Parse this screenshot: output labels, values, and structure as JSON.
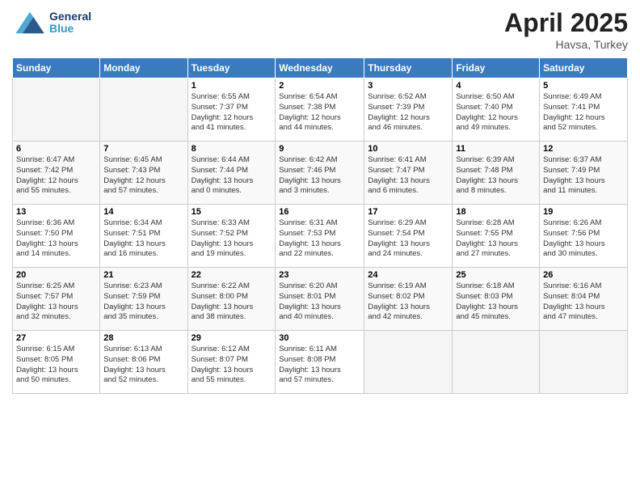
{
  "logo": {
    "general": "General",
    "blue": "Blue"
  },
  "header": {
    "month": "April 2025",
    "location": "Havsa, Turkey"
  },
  "weekdays": [
    "Sunday",
    "Monday",
    "Tuesday",
    "Wednesday",
    "Thursday",
    "Friday",
    "Saturday"
  ],
  "weeks": [
    [
      {
        "day": "",
        "sunrise": "",
        "sunset": "",
        "daylight": ""
      },
      {
        "day": "",
        "sunrise": "",
        "sunset": "",
        "daylight": ""
      },
      {
        "day": "1",
        "sunrise": "Sunrise: 6:55 AM",
        "sunset": "Sunset: 7:37 PM",
        "daylight": "Daylight: 12 hours and 41 minutes."
      },
      {
        "day": "2",
        "sunrise": "Sunrise: 6:54 AM",
        "sunset": "Sunset: 7:38 PM",
        "daylight": "Daylight: 12 hours and 44 minutes."
      },
      {
        "day": "3",
        "sunrise": "Sunrise: 6:52 AM",
        "sunset": "Sunset: 7:39 PM",
        "daylight": "Daylight: 12 hours and 46 minutes."
      },
      {
        "day": "4",
        "sunrise": "Sunrise: 6:50 AM",
        "sunset": "Sunset: 7:40 PM",
        "daylight": "Daylight: 12 hours and 49 minutes."
      },
      {
        "day": "5",
        "sunrise": "Sunrise: 6:49 AM",
        "sunset": "Sunset: 7:41 PM",
        "daylight": "Daylight: 12 hours and 52 minutes."
      }
    ],
    [
      {
        "day": "6",
        "sunrise": "Sunrise: 6:47 AM",
        "sunset": "Sunset: 7:42 PM",
        "daylight": "Daylight: 12 hours and 55 minutes."
      },
      {
        "day": "7",
        "sunrise": "Sunrise: 6:45 AM",
        "sunset": "Sunset: 7:43 PM",
        "daylight": "Daylight: 12 hours and 57 minutes."
      },
      {
        "day": "8",
        "sunrise": "Sunrise: 6:44 AM",
        "sunset": "Sunset: 7:44 PM",
        "daylight": "Daylight: 13 hours and 0 minutes."
      },
      {
        "day": "9",
        "sunrise": "Sunrise: 6:42 AM",
        "sunset": "Sunset: 7:46 PM",
        "daylight": "Daylight: 13 hours and 3 minutes."
      },
      {
        "day": "10",
        "sunrise": "Sunrise: 6:41 AM",
        "sunset": "Sunset: 7:47 PM",
        "daylight": "Daylight: 13 hours and 6 minutes."
      },
      {
        "day": "11",
        "sunrise": "Sunrise: 6:39 AM",
        "sunset": "Sunset: 7:48 PM",
        "daylight": "Daylight: 13 hours and 8 minutes."
      },
      {
        "day": "12",
        "sunrise": "Sunrise: 6:37 AM",
        "sunset": "Sunset: 7:49 PM",
        "daylight": "Daylight: 13 hours and 11 minutes."
      }
    ],
    [
      {
        "day": "13",
        "sunrise": "Sunrise: 6:36 AM",
        "sunset": "Sunset: 7:50 PM",
        "daylight": "Daylight: 13 hours and 14 minutes."
      },
      {
        "day": "14",
        "sunrise": "Sunrise: 6:34 AM",
        "sunset": "Sunset: 7:51 PM",
        "daylight": "Daylight: 13 hours and 16 minutes."
      },
      {
        "day": "15",
        "sunrise": "Sunrise: 6:33 AM",
        "sunset": "Sunset: 7:52 PM",
        "daylight": "Daylight: 13 hours and 19 minutes."
      },
      {
        "day": "16",
        "sunrise": "Sunrise: 6:31 AM",
        "sunset": "Sunset: 7:53 PM",
        "daylight": "Daylight: 13 hours and 22 minutes."
      },
      {
        "day": "17",
        "sunrise": "Sunrise: 6:29 AM",
        "sunset": "Sunset: 7:54 PM",
        "daylight": "Daylight: 13 hours and 24 minutes."
      },
      {
        "day": "18",
        "sunrise": "Sunrise: 6:28 AM",
        "sunset": "Sunset: 7:55 PM",
        "daylight": "Daylight: 13 hours and 27 minutes."
      },
      {
        "day": "19",
        "sunrise": "Sunrise: 6:26 AM",
        "sunset": "Sunset: 7:56 PM",
        "daylight": "Daylight: 13 hours and 30 minutes."
      }
    ],
    [
      {
        "day": "20",
        "sunrise": "Sunrise: 6:25 AM",
        "sunset": "Sunset: 7:57 PM",
        "daylight": "Daylight: 13 hours and 32 minutes."
      },
      {
        "day": "21",
        "sunrise": "Sunrise: 6:23 AM",
        "sunset": "Sunset: 7:59 PM",
        "daylight": "Daylight: 13 hours and 35 minutes."
      },
      {
        "day": "22",
        "sunrise": "Sunrise: 6:22 AM",
        "sunset": "Sunset: 8:00 PM",
        "daylight": "Daylight: 13 hours and 38 minutes."
      },
      {
        "day": "23",
        "sunrise": "Sunrise: 6:20 AM",
        "sunset": "Sunset: 8:01 PM",
        "daylight": "Daylight: 13 hours and 40 minutes."
      },
      {
        "day": "24",
        "sunrise": "Sunrise: 6:19 AM",
        "sunset": "Sunset: 8:02 PM",
        "daylight": "Daylight: 13 hours and 42 minutes."
      },
      {
        "day": "25",
        "sunrise": "Sunrise: 6:18 AM",
        "sunset": "Sunset: 8:03 PM",
        "daylight": "Daylight: 13 hours and 45 minutes."
      },
      {
        "day": "26",
        "sunrise": "Sunrise: 6:16 AM",
        "sunset": "Sunset: 8:04 PM",
        "daylight": "Daylight: 13 hours and 47 minutes."
      }
    ],
    [
      {
        "day": "27",
        "sunrise": "Sunrise: 6:15 AM",
        "sunset": "Sunset: 8:05 PM",
        "daylight": "Daylight: 13 hours and 50 minutes."
      },
      {
        "day": "28",
        "sunrise": "Sunrise: 6:13 AM",
        "sunset": "Sunset: 8:06 PM",
        "daylight": "Daylight: 13 hours and 52 minutes."
      },
      {
        "day": "29",
        "sunrise": "Sunrise: 6:12 AM",
        "sunset": "Sunset: 8:07 PM",
        "daylight": "Daylight: 13 hours and 55 minutes."
      },
      {
        "day": "30",
        "sunrise": "Sunrise: 6:11 AM",
        "sunset": "Sunset: 8:08 PM",
        "daylight": "Daylight: 13 hours and 57 minutes."
      },
      {
        "day": "",
        "sunrise": "",
        "sunset": "",
        "daylight": ""
      },
      {
        "day": "",
        "sunrise": "",
        "sunset": "",
        "daylight": ""
      },
      {
        "day": "",
        "sunrise": "",
        "sunset": "",
        "daylight": ""
      }
    ]
  ]
}
